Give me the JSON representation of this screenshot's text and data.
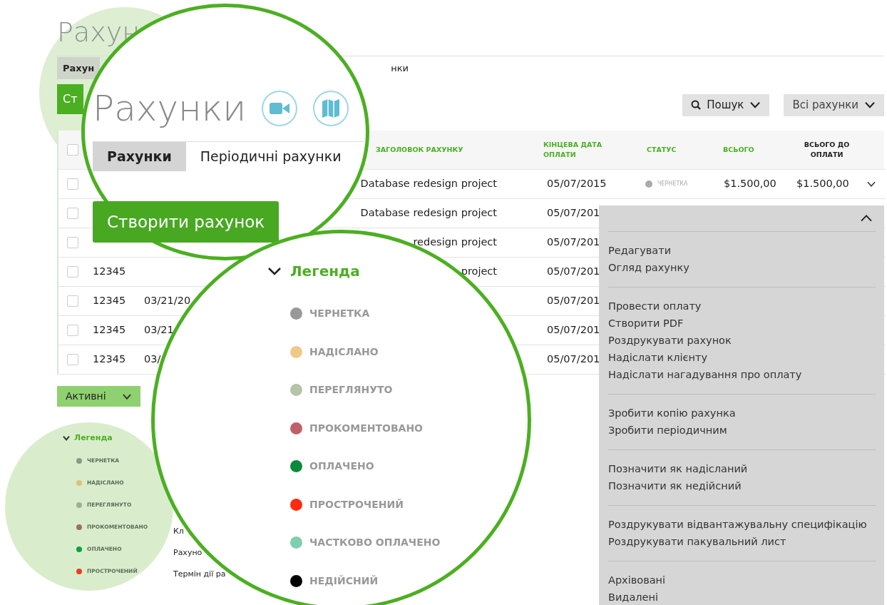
{
  "background_header": {
    "title": "Рахун",
    "tabs": [
      {
        "label": "Рахун",
        "selected": true
      },
      {
        "label": "нки",
        "selected": false
      }
    ],
    "create_button": "Ст"
  },
  "toolbar": {
    "search": "Пошук",
    "filter": "Всі рахунки"
  },
  "table": {
    "select_all_checked": false,
    "columns": [
      {
        "label": "ЗАГОЛОВОК РАХУНКУ",
        "kind": "sortable"
      },
      {
        "label": "КІНЦЕВА ДАТА ОПЛАТИ",
        "kind": "sortable"
      },
      {
        "label": "СТАТУС",
        "kind": "sortable"
      },
      {
        "label": "ВСЬОГО",
        "kind": "sortable"
      },
      {
        "label": "ВСЬОГО ДО ОПЛАТИ",
        "kind": "plain"
      }
    ],
    "rows": [
      {
        "checked": false,
        "title": "Database redesign project",
        "due_date": "05/07/2015",
        "status": {
          "label": "ЧЕРНЕТКА",
          "color": "#aaaaaa"
        },
        "total": "$1.500,00",
        "balance": "$1.500,00",
        "expanded": false
      },
      {
        "checked": false,
        "title": "Database redesign project",
        "due_date": "05/07/201"
      },
      {
        "checked": false,
        "title": "redesign project",
        "due_date": "05/07/201"
      },
      {
        "checked": false,
        "number": "12345",
        "title": "project",
        "due_date": "05/07/201"
      },
      {
        "checked": false,
        "number": "12345",
        "date": "03/21/20",
        "due_date": "05/07/201"
      },
      {
        "checked": false,
        "number": "12345",
        "date": "03/21",
        "due_date": "05/07/201"
      },
      {
        "checked": false,
        "number": "12345",
        "date": "03/",
        "due_date": "05/07/201"
      }
    ]
  },
  "filter_button": "Активні",
  "notes": [
    "Кл",
    "Рахуно",
    "Термін дії ра"
  ],
  "mini_legend": {
    "title": "Легенда",
    "items": [
      {
        "label": "ЧЕРНЕТКА",
        "color": "#8a9a85"
      },
      {
        "label": "НАДІСЛАНО",
        "color": "#e0c07a"
      },
      {
        "label": "ПЕРЕГЛЯНУТО",
        "color": "#a0b098"
      },
      {
        "label": "ПРОКОМЕНТОВАНО",
        "color": "#9a7060"
      },
      {
        "label": "ОПЛАЧЕНО",
        "color": "#10a040"
      },
      {
        "label": "ПРОСТРОЧЕНИЙ",
        "color": "#e84020"
      }
    ]
  },
  "zoom_header": {
    "title": "Рахунки",
    "tabs": [
      {
        "label": "Рахунки",
        "selected": true
      },
      {
        "label": "Періодичні рахунки",
        "selected": false
      }
    ],
    "create_button": "Створити рахунок"
  },
  "zoom_legend": {
    "title": "Легенда",
    "expanded": true,
    "items": [
      {
        "label": "ЧЕРНЕТКА",
        "color": "#999999"
      },
      {
        "label": "НАДІСЛАНО",
        "color": "#f0c98a"
      },
      {
        "label": "ПЕРЕГЛЯНУТО",
        "color": "#b5c4a8"
      },
      {
        "label": "ПРОКОМЕНТОВАНО",
        "color": "#c0616a"
      },
      {
        "label": "ОПЛАЧЕНО",
        "color": "#0a8a3a"
      },
      {
        "label": "ПРОСТРОЧЕНИЙ",
        "color": "#ff2a10"
      },
      {
        "label": "ЧАСТКОВО ОПЛАЧЕНО",
        "color": "#7ecfae"
      },
      {
        "label": "НЕДІЙСНИЙ",
        "color": "#000000"
      }
    ]
  },
  "row_menu": {
    "expanded": true,
    "groups": [
      [
        "Редагувати",
        "Огляд рахунку"
      ],
      [
        "Провести оплату",
        "Створити PDF",
        "Роздрукувати рахунок",
        "Надіслати клієнту",
        "Надіслати нагадування про оплату"
      ],
      [
        "Зробити копію рахунка",
        "Зробити періодичним"
      ],
      [
        "Позначити як надісланий",
        "Позначити як недійсний"
      ],
      [
        "Роздрукувати відвантажувальну специфікацію",
        "Роздрукувати пакувальний лист"
      ],
      [
        "Архівовані",
        "Видалені"
      ]
    ]
  }
}
